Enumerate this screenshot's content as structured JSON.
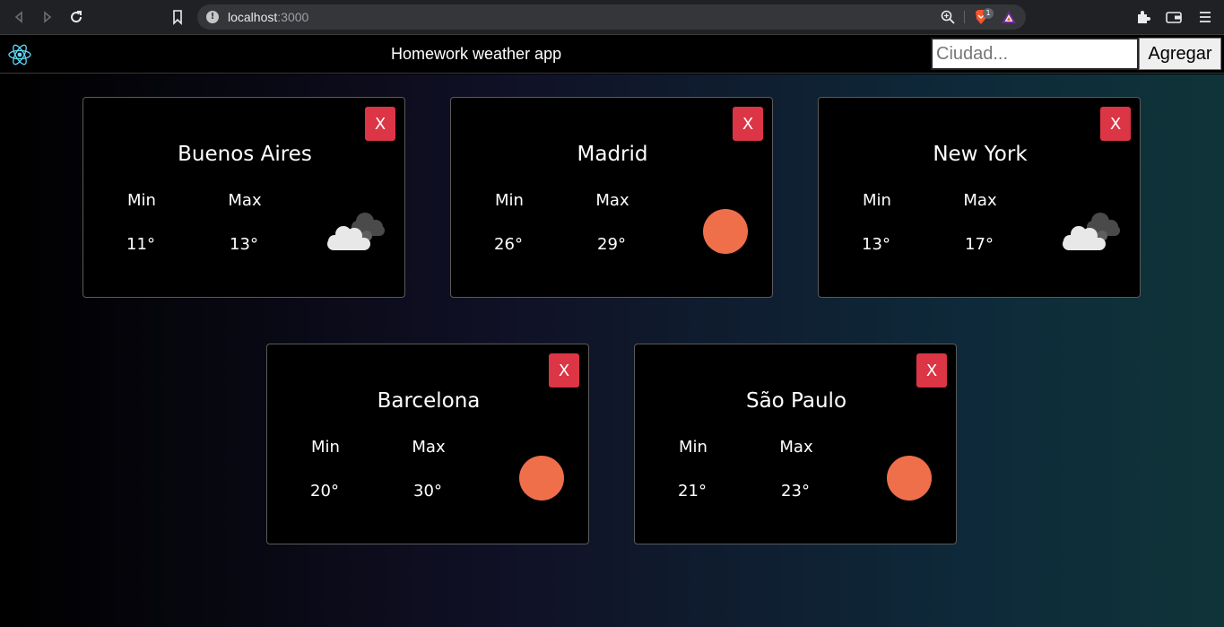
{
  "browser": {
    "url_host": "localhost",
    "url_port": ":3000",
    "shield_count": "1"
  },
  "appbar": {
    "title": "Homework weather app",
    "search_placeholder": "Ciudad...",
    "add_label": "Agregar"
  },
  "labels": {
    "min": "Min",
    "max": "Max",
    "close": "X"
  },
  "cards": [
    {
      "city": "Buenos Aires",
      "min": "11°",
      "max": "13°",
      "icon": "clouds-icon"
    },
    {
      "city": "Madrid",
      "min": "26°",
      "max": "29°",
      "icon": "sun-icon"
    },
    {
      "city": "New York",
      "min": "13°",
      "max": "17°",
      "icon": "clouds-icon"
    },
    {
      "city": "Barcelona",
      "min": "20°",
      "max": "30°",
      "icon": "sun-icon"
    },
    {
      "city": "São Paulo",
      "min": "21°",
      "max": "23°",
      "icon": "sun-icon"
    }
  ],
  "colors": {
    "close_button": "#dc3545",
    "sun": "#ef6f4a",
    "background_start": "#000000",
    "background_end": "#0f3438"
  }
}
